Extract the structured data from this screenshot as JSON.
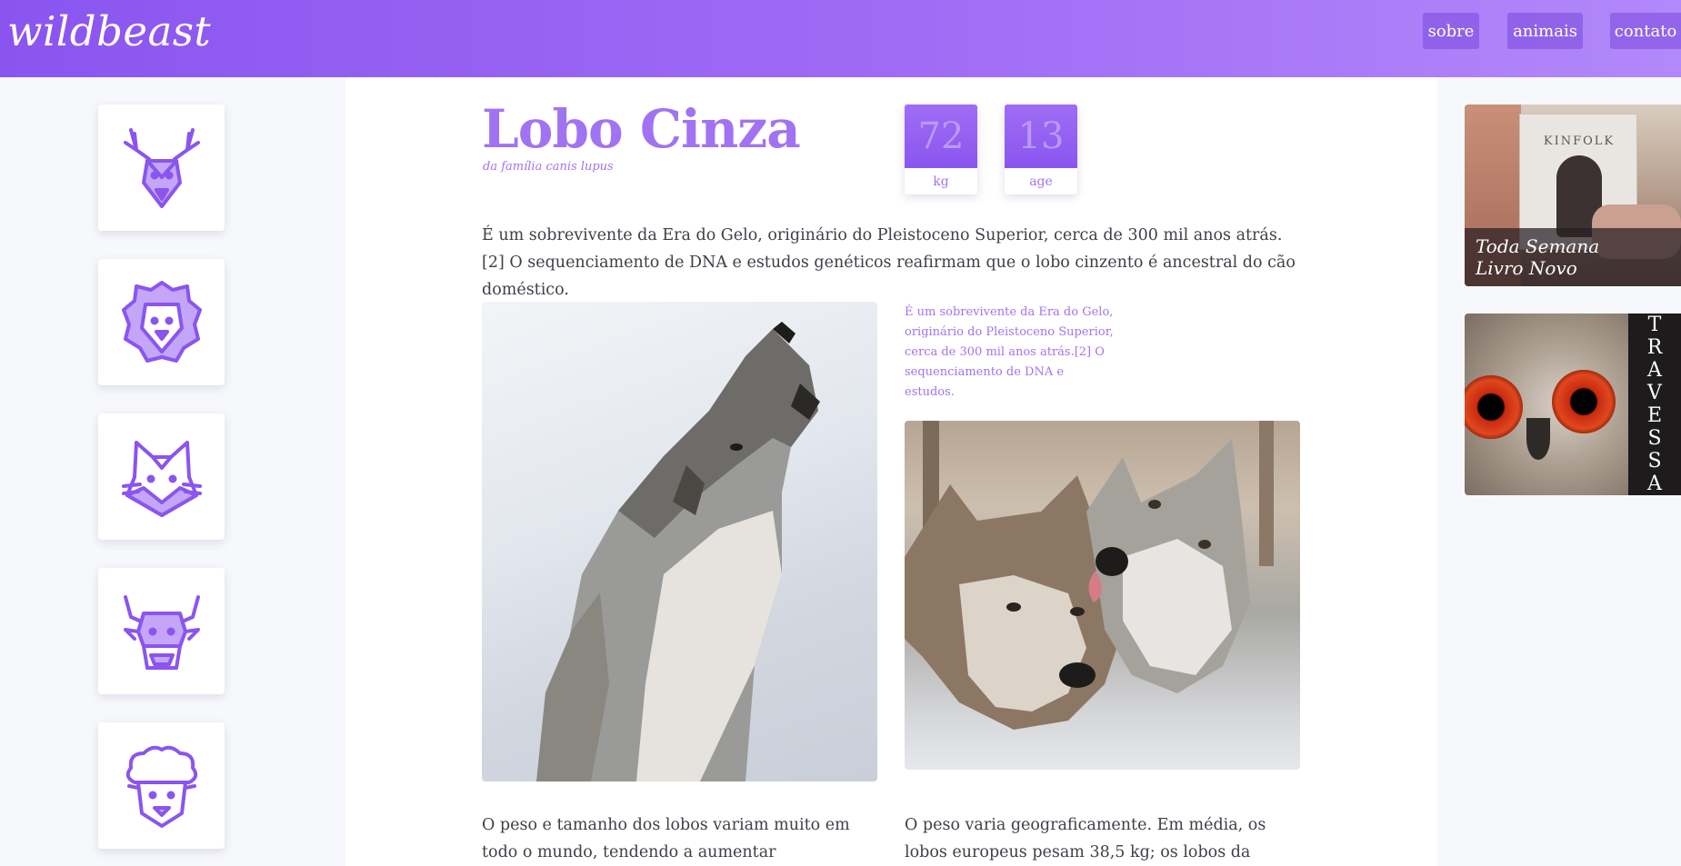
{
  "header": {
    "logo": "wildbeast",
    "nav": [
      "sobre",
      "animais",
      "contato"
    ]
  },
  "sidebar_left": {
    "animals": [
      {
        "icon": "deer-icon"
      },
      {
        "icon": "lion-icon"
      },
      {
        "icon": "fox-icon"
      },
      {
        "icon": "bull-icon"
      },
      {
        "icon": "sheep-icon"
      }
    ]
  },
  "main": {
    "title": "Lobo Cinza",
    "subtitle": "da família canis lupus",
    "stats": [
      {
        "value": "72",
        "label": "kg"
      },
      {
        "value": "13",
        "label": "age"
      }
    ],
    "intro": "É um sobrevivente da Era do Gelo, originário do Pleistoceno Superior, cerca de 300 mil anos atrás.[2] O sequenciamento de DNA e estudos genéticos reafirmam que o lobo cinzento é ancestral do cão doméstico.",
    "side_note": "É um sobrevivente da Era do Gelo, originário do Pleistoceno Superior, cerca de 300 mil anos atrás.[2] O sequenciamento de DNA e estudos.",
    "para_left": "O peso e tamanho dos lobos variam muito em todo o mundo, tendendo a aumentar proporcionalmente",
    "para_right": "O peso varia geograficamente. Em média, os lobos europeus pesam 38,5 kg; os lobos da América do"
  },
  "ads": {
    "kinfolk": {
      "book_title": "KINFOLK",
      "caption_line1": "Toda Semana",
      "caption_line2": "Livro Novo"
    },
    "travessa": {
      "letters": [
        "T",
        "R",
        "A",
        "V",
        "E",
        "S",
        "S",
        "A"
      ]
    }
  },
  "colors": {
    "accent": "#a173f2",
    "header_start": "#8a55ef",
    "header_end": "#b388fa",
    "sidebar_bg": "#f7f8fb",
    "text": "#3f3f48"
  }
}
